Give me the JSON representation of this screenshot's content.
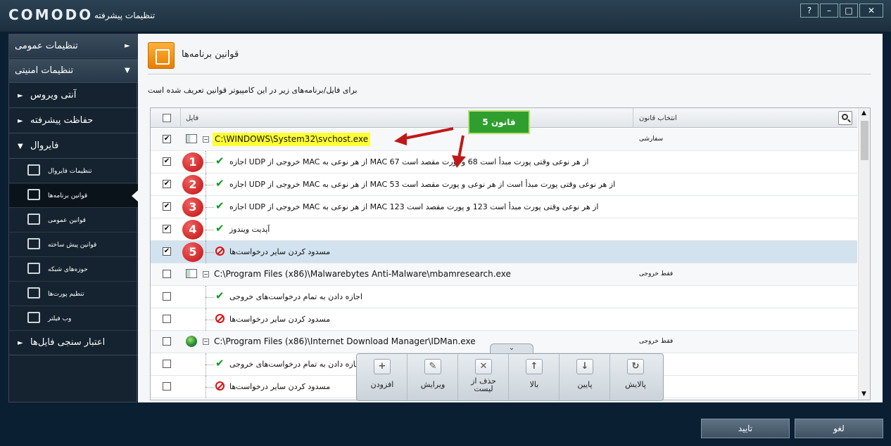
{
  "window": {
    "logo": "COMODO",
    "title": "تنظیمات پیشرفته",
    "buttons": [
      "?",
      "–",
      "□",
      "✕"
    ]
  },
  "sidebar": {
    "top": [
      {
        "label": "تنظیمات عمومی",
        "arrow": "►"
      },
      {
        "label": "تنظیمات امنیتی",
        "arrow": "▼"
      }
    ],
    "sections": [
      {
        "label": "آنتی ویروس",
        "arrow": "►"
      },
      {
        "label": "حفاظت پیشرفته",
        "arrow": "►"
      },
      {
        "label": "فایروال",
        "arrow": "▼"
      }
    ],
    "subitems": [
      "تنظیمات فایروال",
      "قوانین برنامه‌ها",
      "قوانین عمومی",
      "قوانین پیش ساخته",
      "حوزه‌های شبکه",
      "تنظیم پورت‌ها",
      "وب فیلتر"
    ],
    "last": {
      "label": "اعتبار سنجی فایل‌ها",
      "arrow": "►"
    }
  },
  "main": {
    "title": "قوانین برنامه‌ها",
    "description": "برای فایل/برنامه‌های زیر در این کامپیوتر قوانین تعریف شده است",
    "columns": {
      "file": "فایل",
      "rule": "انتخاب قانون"
    },
    "callout": "5 قانون",
    "rows": [
      {
        "type": "group",
        "checked": true,
        "path": "C:\\WINDOWS\\System32\\svchost.exe",
        "rule": "سفارشی"
      },
      {
        "type": "rule",
        "checked": true,
        "badge": "1",
        "text": "اجازه UDP خروجی از MAC از هر نوعی به MAC از هر نوعی وقتی پورت مبدأ است 68 و پورت مقصد است 67"
      },
      {
        "type": "rule",
        "checked": true,
        "badge": "2",
        "text": "اجازه UDP خروجی از MAC از هر نوعی به MAC از هر نوعی وقتی پورت مبدأ است از هر نوعی و پورت مقصد است 53"
      },
      {
        "type": "rule",
        "checked": true,
        "badge": "3",
        "text": "اجازه UDP خروجی از MAC از هر نوعی به MAC از هر نوعی وقتی پورت مبدأ است 123 و پورت مقصد است 123"
      },
      {
        "type": "rule",
        "checked": true,
        "badge": "4",
        "text": "آپدیت ویندوز"
      },
      {
        "type": "block",
        "checked": true,
        "badge": "5",
        "text": "مسدود کردن سایر درخواست‌ها"
      },
      {
        "type": "group",
        "checked": false,
        "path": "C:\\Program Files (x86)\\Malwarebytes Anti-Malware\\mbamresearch.exe",
        "rule": "فقط خروجی"
      },
      {
        "type": "rule",
        "checked": false,
        "text": "اجازه دادن به تمام درخواست‌های خروجی"
      },
      {
        "type": "block",
        "checked": false,
        "text": "مسدود کردن سایر درخواست‌ها"
      },
      {
        "type": "group",
        "checked": false,
        "path": "C:\\Program Files (x86)\\Internet Download Manager\\IDMan.exe",
        "rule": "فقط خروجی"
      },
      {
        "type": "rule",
        "checked": false,
        "text": "اجازه دادن به تمام درخواست‌های خروجی"
      },
      {
        "type": "block",
        "checked": false,
        "text": "مسدود کردن سایر درخواست‌ها"
      }
    ],
    "toolbar": [
      {
        "icon": "+",
        "label": "افزودن"
      },
      {
        "icon": "✎",
        "label": "ویرایش"
      },
      {
        "icon": "✕",
        "label": "حذف از لیست"
      },
      {
        "icon": "↑",
        "label": "بالا"
      },
      {
        "icon": "↓",
        "label": "پایین"
      },
      {
        "icon": "↻",
        "label": "پالایش"
      }
    ]
  },
  "footer": {
    "ok": "تایید",
    "cancel": "لغو"
  }
}
